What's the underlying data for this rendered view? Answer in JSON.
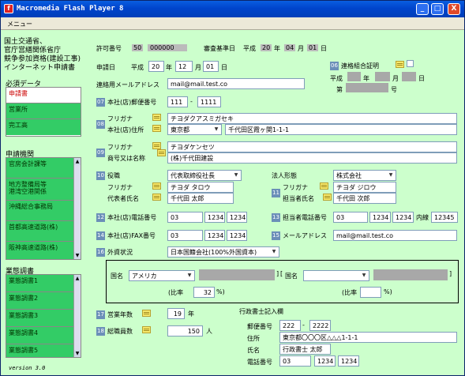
{
  "window": {
    "title": "Macromedia Flash Player 8",
    "min": "_",
    "max": "□",
    "close": "X",
    "menu": "メニュー"
  },
  "sidebar": {
    "org": [
      "国土交通省、",
      "官庁営繕関係省庁",
      "競争参加資格(建設工事)",
      "インターネット申請書"
    ],
    "required_title": "必須データ",
    "required": [
      "申請書",
      "営業所",
      "完工高"
    ],
    "agency_title": "申請機関",
    "agencies": [
      "官房会計課等",
      "地方整備局等\n港湾空港関係",
      "沖縄総合事務局",
      "首都高速道路(株)",
      "阪神高速道路(株)"
    ],
    "survey_title": "業態調書",
    "surveys": [
      "業態調書1",
      "業態調書2",
      "業態調書3",
      "業態調書4",
      "業態調書5"
    ],
    "version": "version 3.0"
  },
  "form": {
    "permit_label": "許可番号",
    "permit_code": "50",
    "permit_no": "000000",
    "exam_label": "審査基準日",
    "exam_era": "平成",
    "exam_y": "20",
    "exam_y_u": "年",
    "exam_m": "04",
    "exam_m_u": "月",
    "exam_d": "01",
    "exam_d_u": "日",
    "apply_label": "申請日",
    "apply_era": "平成",
    "apply_y": "20",
    "apply_y_u": "年",
    "apply_m": "12",
    "apply_m_u": "月",
    "apply_d": "01",
    "apply_d_u": "日",
    "n06": "06",
    "union_label": "連格組合証明",
    "union_era": "平成",
    "union_y_u": "年",
    "union_m_u": "月",
    "union_d_u": "日",
    "union_no_pre": "第",
    "union_no_u": "号",
    "email_label": "連絡用メールアドレス",
    "email": "mail@mail.test.co",
    "n07": "07",
    "zip_label": "本社(店)郵便番号",
    "zip1": "111",
    "zip_dash": "-",
    "zip2": "1111",
    "n08": "08",
    "furigana": "フリガナ",
    "addr_kana": "チヨダクアスミガセキ",
    "addr_label": "本社(店)住所",
    "pref": "東京都",
    "addr": "千代田区霞ヶ関1-1-1",
    "n09": "09",
    "name_kana": "チヨダケンセツ",
    "name_label": "商号又は名称",
    "name": "(株)千代田建設",
    "n10": "10",
    "role_label": "役職",
    "role": "代表取締役社長",
    "rep_kana": "チヨダ タロウ",
    "rep_label": "代表者氏名",
    "rep": "千代田 太郎",
    "corp_label": "法人形態",
    "corp": "株式会社",
    "n11": "11",
    "charge_kana": "チヨダ ジロウ",
    "charge_label": "担当者氏名",
    "charge": "千代田 次郎",
    "n12": "12",
    "tel_label": "本社(店)電話番号",
    "tel1": "03",
    "tel2": "1234",
    "tel3": "1234",
    "n13": "13",
    "ctel_label": "担当者電話番号",
    "ctel1": "03",
    "ctel2": "1234",
    "ctel3": "1234",
    "ext_label": "内線",
    "ext": "12345",
    "n14": "14",
    "fax_label": "本社(店)FAX番号",
    "fax1": "03",
    "fax2": "1234",
    "fax3": "1234",
    "n15": "15",
    "mail_label": "メールアドレス",
    "mail": "mail@mail.test.co",
    "n16": "16",
    "foreign_label": "外資状況",
    "foreign": "日本国籍会社(100%外国資本)",
    "country_label": "国名",
    "country": "アメリカ",
    "bracket_open": "[",
    "bracket_close": "]",
    "country2_label": "国名",
    "ratio_label": "(比率",
    "ratio": "32",
    "ratio_u": "%)",
    "ratio2_label": "(比率",
    "ratio2_u": "%)",
    "n17": "17",
    "years_label": "営業年数",
    "years": "19",
    "years_u": "年",
    "n18": "18",
    "staff_label": "総職員数",
    "staff": "150",
    "staff_u": "人",
    "scrivener_title": "行政書士記入欄",
    "s_zip_label": "郵便番号",
    "s_zip1": "222",
    "s_zip_dash": "-",
    "s_zip2": "2222",
    "s_addr_label": "住所",
    "s_addr": "東京都〇〇〇区△△△1-1-1",
    "s_name_label": "氏名",
    "s_name": "行政書士 太郎",
    "s_tel_label": "電話番号",
    "s_tel1": "03",
    "s_tel2": "1234",
    "s_tel3": "1234"
  }
}
